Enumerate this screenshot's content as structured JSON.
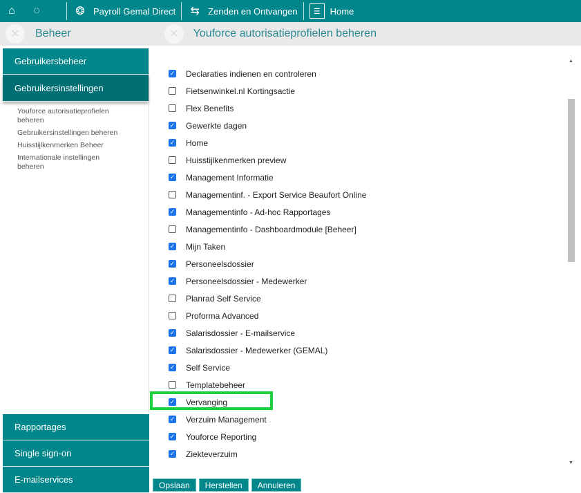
{
  "topbar": {
    "home_icon": "home-icon",
    "refresh_icon": "loading-icon",
    "items": [
      {
        "label": "Payroll Gemal Direct",
        "icon": "coins-icon"
      },
      {
        "label": "Zenden en Ontvangen",
        "icon": "transfer-icon"
      },
      {
        "label": "Home",
        "icon": "id-card-icon"
      }
    ]
  },
  "subbar": {
    "left_title": "Beheer",
    "main_title": "Youforce autorisatieprofielen beheren",
    "icon": "tools-icon"
  },
  "sidebar": {
    "top": [
      {
        "label": "Gebruikersbeheer"
      },
      {
        "label": "Gebruikersinstellingen"
      }
    ],
    "subitems": [
      "Youforce autorisatieprofielen beheren",
      "Gebruikersinstellingen beheren",
      "Huisstijlkenmerken Beheer",
      "Internationale instellingen beheren"
    ],
    "bottom": [
      {
        "label": "Rapportages"
      },
      {
        "label": "Single sign-on"
      },
      {
        "label": "E-mailservices"
      }
    ]
  },
  "permissions": [
    {
      "label": "Declaraties indienen en controleren",
      "checked": true
    },
    {
      "label": "Fietsenwinkel.nl Kortingsactie",
      "checked": false
    },
    {
      "label": "Flex Benefits",
      "checked": false
    },
    {
      "label": "Gewerkte dagen",
      "checked": true
    },
    {
      "label": "Home",
      "checked": true
    },
    {
      "label": "Huisstijlkenmerken preview",
      "checked": false
    },
    {
      "label": "Management Informatie",
      "checked": true
    },
    {
      "label": "Managementinf. - Export Service Beaufort Online",
      "checked": false
    },
    {
      "label": "Managementinfo - Ad-hoc Rapportages",
      "checked": true
    },
    {
      "label": "Managementinfo - Dashboardmodule [Beheer]",
      "checked": false
    },
    {
      "label": "Mijn Taken",
      "checked": true
    },
    {
      "label": "Personeelsdossier",
      "checked": true
    },
    {
      "label": "Personeelsdossier - Medewerker",
      "checked": true
    },
    {
      "label": "Planrad Self Service",
      "checked": false
    },
    {
      "label": "Proforma Advanced",
      "checked": false
    },
    {
      "label": "Salarisdossier - E-mailservice",
      "checked": true
    },
    {
      "label": "Salarisdossier - Medewerker (GEMAL)",
      "checked": true
    },
    {
      "label": "Self Service",
      "checked": true
    },
    {
      "label": "Templatebeheer",
      "checked": false
    },
    {
      "label": "Vervanging",
      "checked": true
    },
    {
      "label": "Verzuim Management",
      "checked": true
    },
    {
      "label": "Youforce Reporting",
      "checked": true
    },
    {
      "label": "Ziekteverzuim",
      "checked": true
    }
  ],
  "buttons": {
    "save": "Opslaan",
    "reset": "Herstellen",
    "cancel": "Annuleren"
  },
  "colors": {
    "teal": "#00868b",
    "highlight": "#1ed03c",
    "checkbox": "#1a73e8"
  }
}
